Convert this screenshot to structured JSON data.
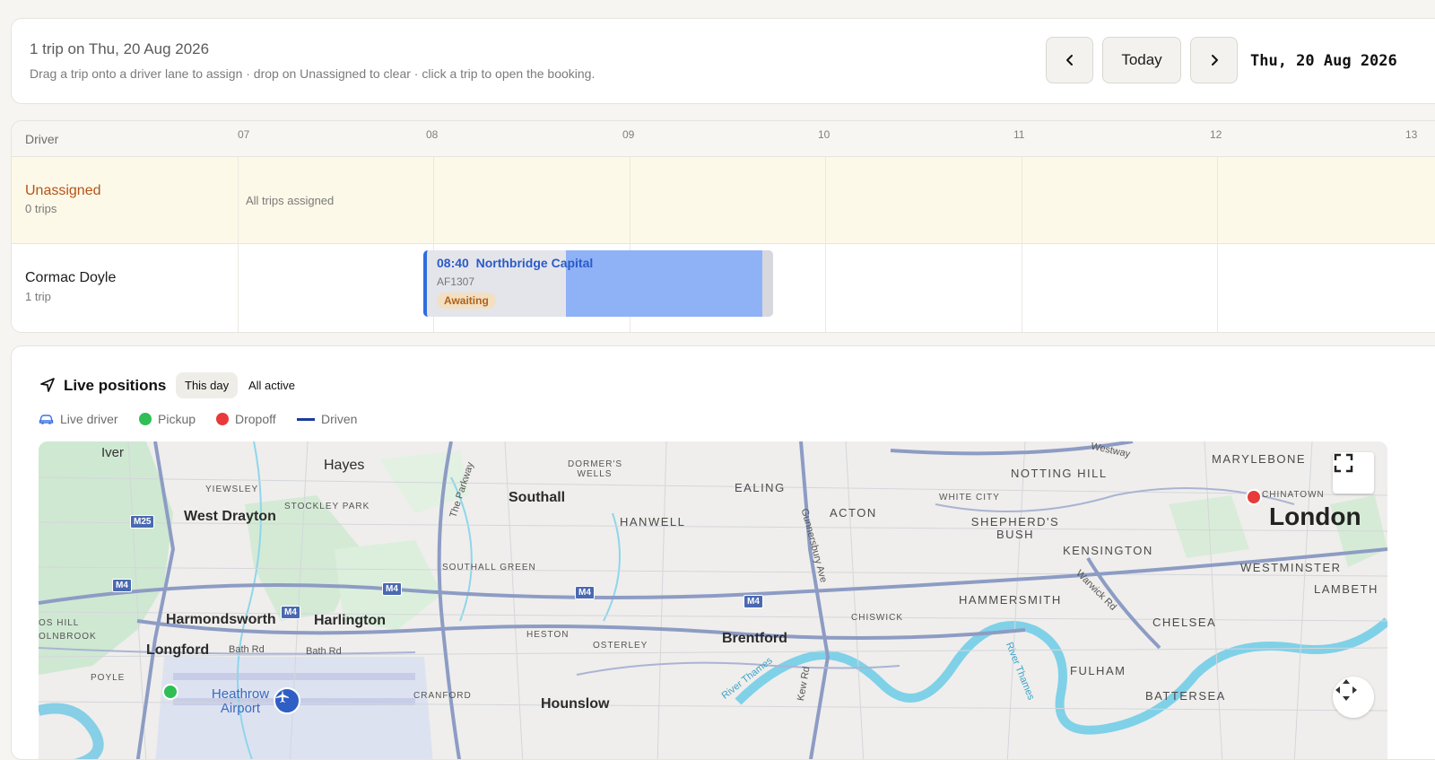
{
  "header": {
    "title": "1 trip on Thu, 20 Aug 2026",
    "subtitle": "Drag a trip onto a driver lane to assign · drop on Unassigned to clear · click a trip to open the booking.",
    "prev_icon": "chevron-left-icon",
    "today_label": "Today",
    "next_icon": "chevron-right-icon",
    "date_label": "Thu, 20 Aug 2026"
  },
  "timeline": {
    "driver_col_label": "Driver",
    "hours": [
      "07",
      "08",
      "09",
      "10",
      "11",
      "12",
      "13"
    ],
    "lanes": [
      {
        "name": "Unassigned",
        "count": "0 trips",
        "empty_note": "All trips assigned"
      },
      {
        "name": "Cormac Doyle",
        "count": "1 trip"
      }
    ],
    "trip": {
      "time": "08:40",
      "client": "Northbridge Capital",
      "ref": "AF1307",
      "status": "Awaiting"
    }
  },
  "live": {
    "icon": "navigation-icon",
    "title": "Live positions",
    "filters": [
      "This day",
      "All active"
    ],
    "legend": [
      {
        "label": "Live driver",
        "icon": "car-icon",
        "color": "#3b73e0"
      },
      {
        "label": "Pickup",
        "color": "#2fbf55"
      },
      {
        "label": "Dropoff",
        "color": "#e83a3a"
      },
      {
        "label": "Driven",
        "color": "#1e3a9c"
      }
    ]
  },
  "map": {
    "labels": {
      "iver": "Iver",
      "hayes": "Hayes",
      "dormers_wells": "DORMER'S WELLS",
      "the_parkway": "The Parkway",
      "southall": "Southall",
      "ealing": "EALING",
      "westway": "Westway",
      "notting_hill": "NOTTING HILL",
      "marylebone": "MARYLEBONE",
      "yiewsley": "YIEWSLEY",
      "west_drayton": "West Drayton",
      "stockley_park": "STOCKLEY PARK",
      "hanwell": "HANWELL",
      "white_city": "WHITE CITY",
      "acton": "ACTON",
      "shepherds_bush": "SHEPHERD'S BUSH",
      "chinatown": "CHINATOWN",
      "london": "London",
      "gunnersbury": "Gunnersbury Ave",
      "kensington": "KENSINGTON",
      "southall_green": "SOUTHALL GREEN",
      "westminster": "WESTMINSTER",
      "lambeth": "LAMBETH",
      "hammersmith": "HAMMERSMITH",
      "warwick_rd": "Warwick Rd",
      "harmondsworth": "Harmondsworth",
      "harlington": "Harlington",
      "chiswick": "CHISWICK",
      "chelsea": "CHELSEA",
      "olnbrook": "OLNBROOK",
      "os_hill": "OS HILL",
      "longford": "Longford",
      "bath_rd_1": "Bath Rd",
      "bath_rd_2": "Bath Rd",
      "heston": "HESTON",
      "osterley": "OSTERLEY",
      "brentford": "Brentford",
      "river_thames_1": "River Thames",
      "river_thames_2": "River Thames",
      "fulham": "FULHAM",
      "poyle": "POYLE",
      "heathrow": "Heathrow Airport",
      "cranford": "CRANFORD",
      "hounslow": "Hounslow",
      "kew_rd": "Kew Rd",
      "battersea": "BATTERSEA"
    },
    "shields": {
      "m25": "M25",
      "m4": "M4"
    },
    "fullscreen_icon": "fullscreen-icon",
    "recenter_icon": "recenter-icon"
  }
}
